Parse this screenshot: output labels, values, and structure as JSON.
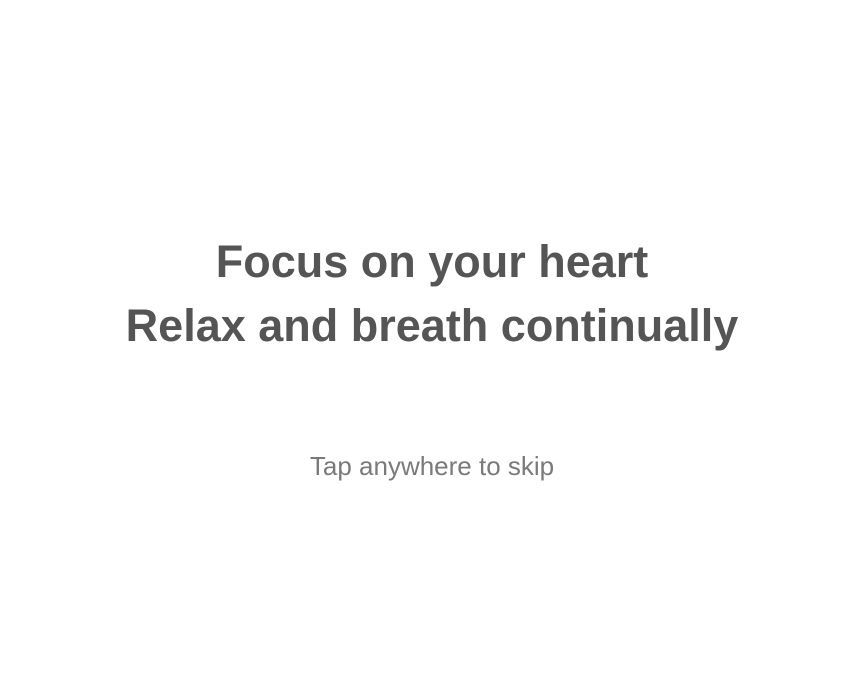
{
  "instructions": {
    "line1": "Focus on your heart",
    "line2": "Relax and breath continually"
  },
  "skip_hint": "Tap anywhere to skip",
  "colors": {
    "background": "#ffffff",
    "heading_text": "#555555",
    "hint_text": "#7a7a7a"
  }
}
